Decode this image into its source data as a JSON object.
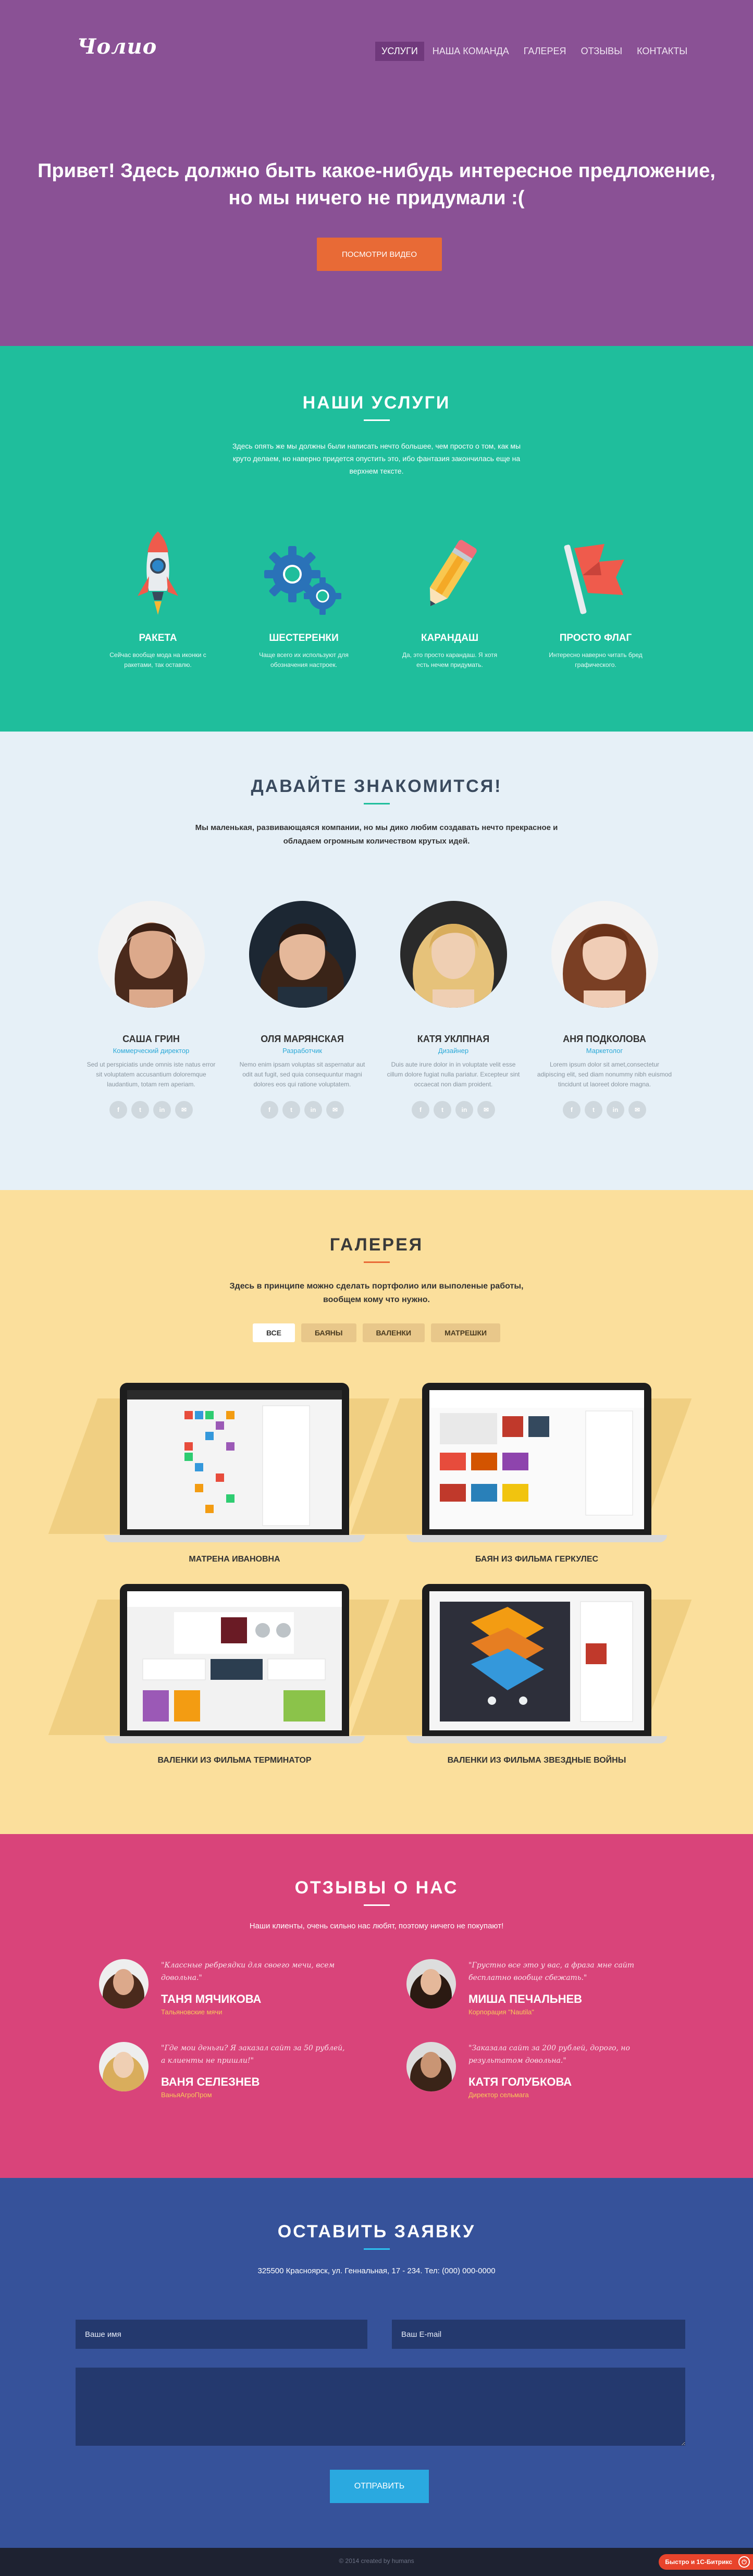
{
  "header": {
    "logo": "Чолио",
    "nav": [
      "УСЛУГИ",
      "НАША КОМАНДА",
      "ГАЛЕРЕЯ",
      "ОТЗЫВЫ",
      "КОНТАКТЫ"
    ],
    "active_index": 0
  },
  "hero": {
    "title_line1": "Привет! Здесь должно быть какое-нибудь интересное предложение,",
    "title_line2": "но мы ничего не придумали :(",
    "button": "ПОСМОТРИ ВИДЕО"
  },
  "services": {
    "title": "НАШИ УСЛУГИ",
    "intro": "Здесь опять же мы должны были написать нечто большее, чем просто о том, как мы круто делаем, но наверно придется опустить это, ибо фантазия закончилась еще на верхнем тексте.",
    "items": [
      {
        "icon": "rocket-icon",
        "name": "РАКЕТА",
        "desc": "Сейчас вообще мода на иконки с ракетами, так оставлю."
      },
      {
        "icon": "gears-icon",
        "name": "ШЕСТЕРЕНКИ",
        "desc": "Чаще всего их используют для обозначения настроек."
      },
      {
        "icon": "pencil-icon",
        "name": "КАРАНДАШ",
        "desc": "Да, это просто карандаш. Я хотя есть нечем придумать."
      },
      {
        "icon": "flag-icon",
        "name": "ПРОСТО ФЛАГ",
        "desc": "Интересно наверно читать бред графического."
      }
    ]
  },
  "team": {
    "title": "ДАВАЙТЕ ЗНАКОМИТСЯ!",
    "intro": "Мы маленькая, развивающаяся компании, но мы дико любим создавать нечто прекрасное и обладаем огромным количеством крутых идей.",
    "members": [
      {
        "name": "САША ГРИН",
        "role": "Коммерческий директор",
        "bio": "Sed ut perspiciatis unde omnis iste natus error sit voluptatem accusantium doloremque laudantium, totam rem aperiam."
      },
      {
        "name": "ОЛЯ МАРЯНСКАЯ",
        "role": "Разработчик",
        "bio": "Nemo enim ipsam voluptas sit aspernatur aut odit aut fugit, sed quia consequuntur magni dolores eos qui ratione voluptatem."
      },
      {
        "name": "КАТЯ УКЛПНАЯ",
        "role": "Дизайнер",
        "bio": "Duis aute irure dolor in in voluptate velit esse cillum dolore fugiat nulla pariatur. Excepteur sint occaecat non diam proident."
      },
      {
        "name": "АНЯ ПОДКОЛОВА",
        "role": "Маркетолог",
        "bio": "Lorem ipsum dolor sit amet,consectetur adipiscing elit, sed diam nonummy nibh euismod tincidunt ut laoreet dolore magna."
      }
    ],
    "socials": [
      "f",
      "t",
      "in",
      "✉"
    ]
  },
  "gallery": {
    "title": "ГАЛЕРЕЯ",
    "intro": "Здесь в принципе можно сделать портфолио или выполеные работы, вообщем кому что нужно.",
    "filters": [
      "ВСЕ",
      "БАЯНЫ",
      "ВАЛЕНКИ",
      "МАТРЕШКИ"
    ],
    "active_filter": 0,
    "items": [
      {
        "caption": "МАТРЕНА ИВАНОВНА"
      },
      {
        "caption": "БАЯН ИЗ ФИЛЬМА ГЕРКУЛЕС"
      },
      {
        "caption": "ВАЛЕНКИ ИЗ ФИЛЬМА ТЕРМИНАТОР"
      },
      {
        "caption": "ВАЛЕНКИ ИЗ ФИЛЬМА ЗВЕЗДНЫЕ ВОЙНЫ"
      }
    ]
  },
  "testimonials": {
    "title": "ОТЗЫВЫ О НАС",
    "intro": "Наши клиенты, очень сильно нас любят, поэтому ничего не покупают!",
    "items": [
      {
        "quote": "\"Классные ребреядки для своего мечи, всем довольна.\"",
        "name": "ТАНЯ МЯЧИКОВА",
        "company": "Тальяновские мячи"
      },
      {
        "quote": "\"Грустно все это у вас, а фраза мне сайт бесплатно вообще сбежать.\"",
        "name": "МИША ПЕЧАЛЬНЕВ",
        "company": "Корпорация \"Nautila\""
      },
      {
        "quote": "\"Где мои деньги? Я заказал сайт за 50 рублей, а клиенты не пришли!\"",
        "name": "ВАНЯ СЕЛЕЗНЕВ",
        "company": "ВаньяАгроПром"
      },
      {
        "quote": "\"Заказала сайт за 200 рублей, дорого, но результатом довольна.\"",
        "name": "КАТЯ ГОЛУБКОВА",
        "company": "Директор сельмага"
      }
    ]
  },
  "contact": {
    "title": "ОСТАВИТЬ ЗАЯВКУ",
    "address": "325500 Красноярск, ул. Геннальная, 17 - 234. Тел: (000) 000-0000",
    "name_placeholder": "Ваше имя",
    "email_placeholder": "Ваш E-mail",
    "button": "ОТПРАВИТЬ"
  },
  "footer": {
    "copyright": "© 2014 created by humans",
    "widget": "Быстро и 1С-Битрикс"
  },
  "colors": {
    "hero": "#8a5195",
    "services": "#1fbe9c",
    "team": "#e6f0f7",
    "gallery": "#fbdf9c",
    "testimonials": "#d9447a",
    "contact": "#36529a",
    "accent_orange": "#e86a36"
  }
}
